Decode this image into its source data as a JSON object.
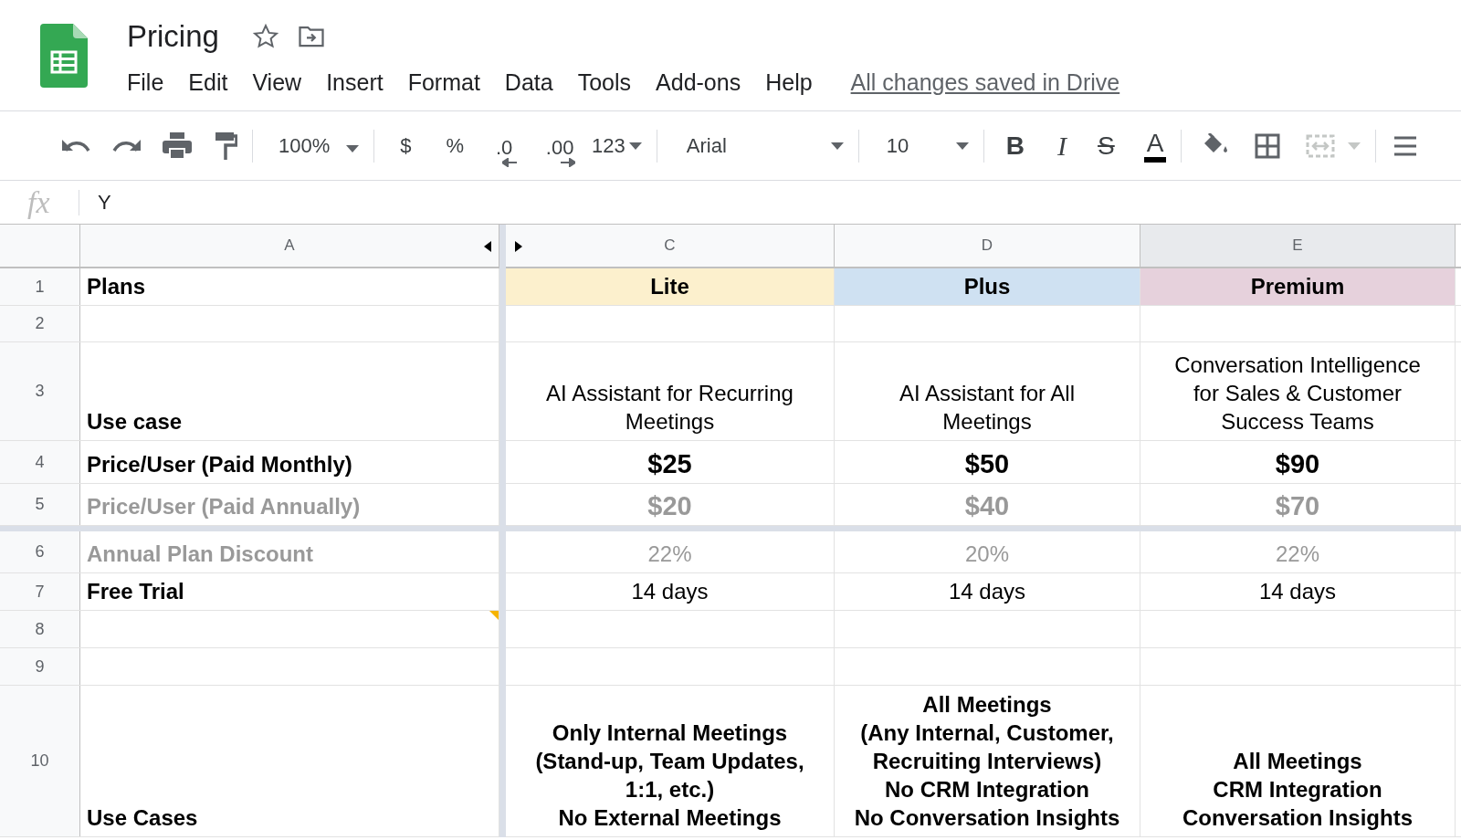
{
  "document": {
    "title": "Pricing",
    "save_status": "All changes saved in Drive"
  },
  "menu": [
    "File",
    "Edit",
    "View",
    "Insert",
    "Format",
    "Data",
    "Tools",
    "Add-ons",
    "Help"
  ],
  "toolbar": {
    "zoom": "100%",
    "currency": "$",
    "percent": "%",
    "decrease_decimals": ".0",
    "increase_decimals": ".00",
    "more_formats": "123",
    "font": "Arial",
    "font_size": "10",
    "bold": "B",
    "italic": "I",
    "strikethrough": "S",
    "text_color": "A"
  },
  "formula_bar": {
    "label": "fx",
    "value": "Y"
  },
  "columns": [
    {
      "label": "A",
      "selected": false
    },
    {
      "label": "C",
      "selected": false
    },
    {
      "label": "D",
      "selected": false
    },
    {
      "label": "E",
      "selected": true
    }
  ],
  "rows": [
    {
      "number": "1",
      "cells": [
        {
          "text": "Plans",
          "bold": true,
          "muted": false
        },
        {
          "text": "Lite",
          "bold": true,
          "muted": false,
          "color": "#fcf0cd"
        },
        {
          "text": "Plus",
          "bold": true,
          "muted": false,
          "color": "#cfe1f2"
        },
        {
          "text": "Premium",
          "bold": true,
          "muted": false,
          "color": "#e6d1dc"
        }
      ]
    },
    {
      "number": "2",
      "cells": [
        {},
        {},
        {},
        {}
      ]
    },
    {
      "number": "3",
      "cells": [
        {
          "text": "Use case",
          "bold": true,
          "muted": false
        },
        {
          "text": "AI Assistant for Recurring\nMeetings",
          "bold": false,
          "muted": false
        },
        {
          "text": "AI Assistant for All\nMeetings",
          "bold": false,
          "muted": false
        },
        {
          "text": "Conversation Intelligence\nfor Sales & Customer\nSuccess Teams",
          "bold": false,
          "muted": false
        }
      ]
    },
    {
      "number": "4",
      "cells": [
        {
          "text": "Price/User (Paid Monthly)",
          "bold": true,
          "muted": false
        },
        {
          "text": "$25",
          "bold": true,
          "muted": false,
          "big": true
        },
        {
          "text": "$50",
          "bold": true,
          "muted": false,
          "big": true
        },
        {
          "text": "$90",
          "bold": true,
          "muted": false,
          "big": true
        }
      ]
    },
    {
      "number": "5",
      "cells": [
        {
          "text": "Price/User (Paid Annually)",
          "bold": true,
          "muted": true
        },
        {
          "text": "$20",
          "bold": true,
          "muted": true,
          "big": true
        },
        {
          "text": "$40",
          "bold": true,
          "muted": true,
          "big": true
        },
        {
          "text": "$70",
          "bold": true,
          "muted": true,
          "big": true
        }
      ]
    },
    {
      "number": "6",
      "cells": [
        {
          "text": "Annual Plan Discount",
          "bold": true,
          "muted": true
        },
        {
          "text": "22%",
          "bold": false,
          "muted": true
        },
        {
          "text": "20%",
          "bold": false,
          "muted": true
        },
        {
          "text": "22%",
          "bold": false,
          "muted": true
        }
      ]
    },
    {
      "number": "7",
      "cells": [
        {
          "text": "Free Trial",
          "bold": true,
          "muted": false
        },
        {
          "text": "14 days",
          "bold": false,
          "muted": false
        },
        {
          "text": "14 days",
          "bold": false,
          "muted": false
        },
        {
          "text": "14 days",
          "bold": false,
          "muted": false
        }
      ]
    },
    {
      "number": "8",
      "cells": [
        {
          "has_note": true
        },
        {},
        {},
        {}
      ]
    },
    {
      "number": "9",
      "cells": [
        {},
        {},
        {},
        {}
      ]
    },
    {
      "number": "10",
      "cells": [
        {
          "text": "Use Cases",
          "bold": true,
          "muted": false
        },
        {
          "text": "Only Internal Meetings\n(Stand-up, Team Updates,\n1:1, etc.)\nNo External Meetings",
          "bold": true,
          "muted": false
        },
        {
          "text": "All Meetings\n(Any Internal, Customer,\nRecruiting Interviews)\nNo CRM Integration\nNo Conversation Insights",
          "bold": true,
          "muted": false
        },
        {
          "text": "All Meetings\nCRM Integration\nConversation Insights",
          "bold": true,
          "muted": false
        }
      ]
    }
  ]
}
